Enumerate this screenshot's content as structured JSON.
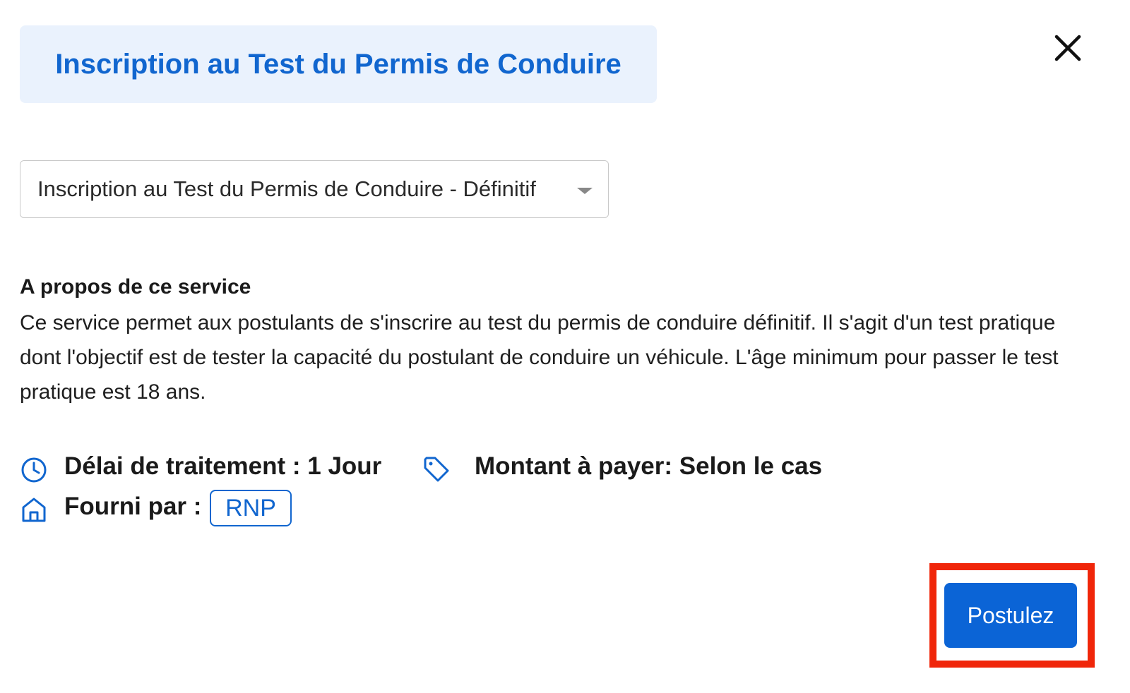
{
  "header": {
    "title": "Inscription au Test du Permis de Conduire"
  },
  "close": {
    "icon": "close-icon"
  },
  "service_select": {
    "selected_value": "Inscription au Test du Permis de Conduire - Définitif"
  },
  "about": {
    "heading": "A propos de ce service",
    "body": "Ce service permet aux postulants de s'inscrire au test du permis de conduire définitif. Il s'agit d'un test pratique dont l'objectif est de tester la capacité du postulant de conduire un véhicule. L'âge minimum pour passer le test pratique est 18 ans."
  },
  "info": {
    "processing_time": "Délai de traitement : 1 Jour",
    "amount": "Montant à payer: Selon le cas",
    "provided_by_label": "Fourni par :",
    "provider": "RNP"
  },
  "actions": {
    "apply_label": "Postulez"
  },
  "colors": {
    "accent": "#1166cf",
    "title_bg": "#eaf2fd",
    "button_bg": "#0b64d6",
    "highlight": "#f0260a"
  }
}
